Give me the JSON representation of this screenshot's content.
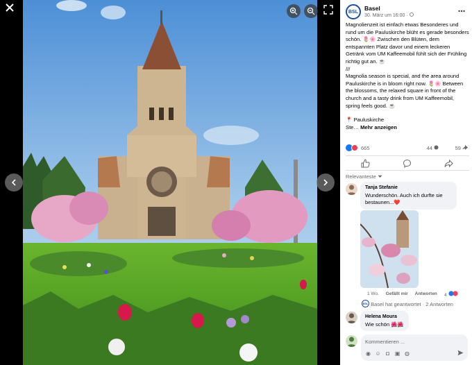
{
  "viewer": {
    "close_icon": "close-icon",
    "zoom_in_icon": "zoom-in-icon",
    "zoom_out_icon": "zoom-out-icon",
    "expand_icon": "expand-icon",
    "prev_icon": "chevron-left-icon",
    "next_icon": "chevron-right-icon"
  },
  "post": {
    "page_name": "Basel",
    "avatar_text": "BSL",
    "date": "30. März um 16:00 · ",
    "text_de": "Magnolienzeit ist einfach etwas Besonderes und rund um die Pauluskirche blüht es gerade besonders schön. 🌷🌸 Zwischen den Blüten, dem entspannten Platz davor und einem leckeren Getränk vom UM Kaffeemobil fühlt sich der Frühling richtig gut an. ☕",
    "separator": "///",
    "text_en": "Magnolia season is special, and the area around Pauluskirche is in bloom right now. 🌷🌸 Between the blossoms, the relaxed square in front of the church and a tasty drink from UM Kaffeemobil, spring feels good. ☕",
    "location": "📍 Pauluskirche",
    "truncated": "Ste… ",
    "see_more": "Mehr anzeigen"
  },
  "stats": {
    "reactions": "665",
    "comments": "44",
    "shares": "59"
  },
  "sort_label": "Relevanteste",
  "comments": [
    {
      "name": "Tanja Stefanie",
      "text": "Wunderschön. Auch ich durfte sie bestaunen...❤️",
      "time": "1 Wo.",
      "like": "Gefällt mir",
      "reply": "Antworten",
      "reaction_count": "4"
    },
    {
      "name": "Helena Moura",
      "text": "Wie schön 🌺🌺"
    }
  ],
  "reply_summary": "Basel hat geantwortet · 2 Antworten",
  "composer": {
    "placeholder": "Kommentieren ..."
  },
  "colors": {
    "accent": "#1877f2",
    "love": "#f33e58"
  }
}
